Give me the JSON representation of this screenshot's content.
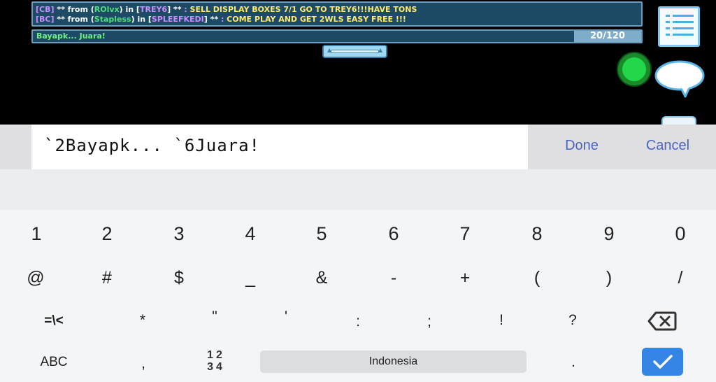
{
  "chat": {
    "line1": {
      "prefix": "[CB]",
      "mid": " ** from (",
      "name": "ROlvx",
      "in_text": ") in [",
      "channel": "TREY6",
      "stars": "] **",
      "colon": " : ",
      "message": "SELL DISPLAY BOXES 7/1 GO TO TREY6!!!HAVE TONS"
    },
    "line2": {
      "prefix": "[BC]",
      "mid": " ** from (",
      "name": "Stapless",
      "in_text": ") in [",
      "channel": "SPLEEFKEDI",
      "stars": "] **",
      "colon": " : ",
      "message": "COME PLAY AND GET 2WLS EASY FREE !!!"
    },
    "input_preview": "Bayapk... Juara!",
    "counter": "20/120"
  },
  "edit_bar": {
    "value": "`2Bayapk... `6Juara!",
    "done_label": "Done",
    "cancel_label": "Cancel"
  },
  "keyboard": {
    "row1": [
      "1",
      "2",
      "3",
      "4",
      "5",
      "6",
      "7",
      "8",
      "9",
      "0"
    ],
    "row2": [
      "@",
      "#",
      "$",
      "_",
      "&",
      "-",
      "+",
      "(",
      ")",
      "/"
    ],
    "row3": [
      "=\\<",
      "*",
      "\"",
      "'",
      ":",
      ";",
      "!",
      "?"
    ],
    "abc_label": "ABC",
    "comma": ",",
    "numpad_label_top": "12",
    "numpad_label_bottom": "34",
    "space_label": "Indonesia",
    "period": ".",
    "backspace_icon": "backspace-icon",
    "enter_icon": "checkmark-icon"
  },
  "colors": {
    "chat_bg": "#1d4a64",
    "accent_blue": "#3585e6",
    "link_blue": "#4b65bf",
    "online_green": "#22d84a"
  }
}
